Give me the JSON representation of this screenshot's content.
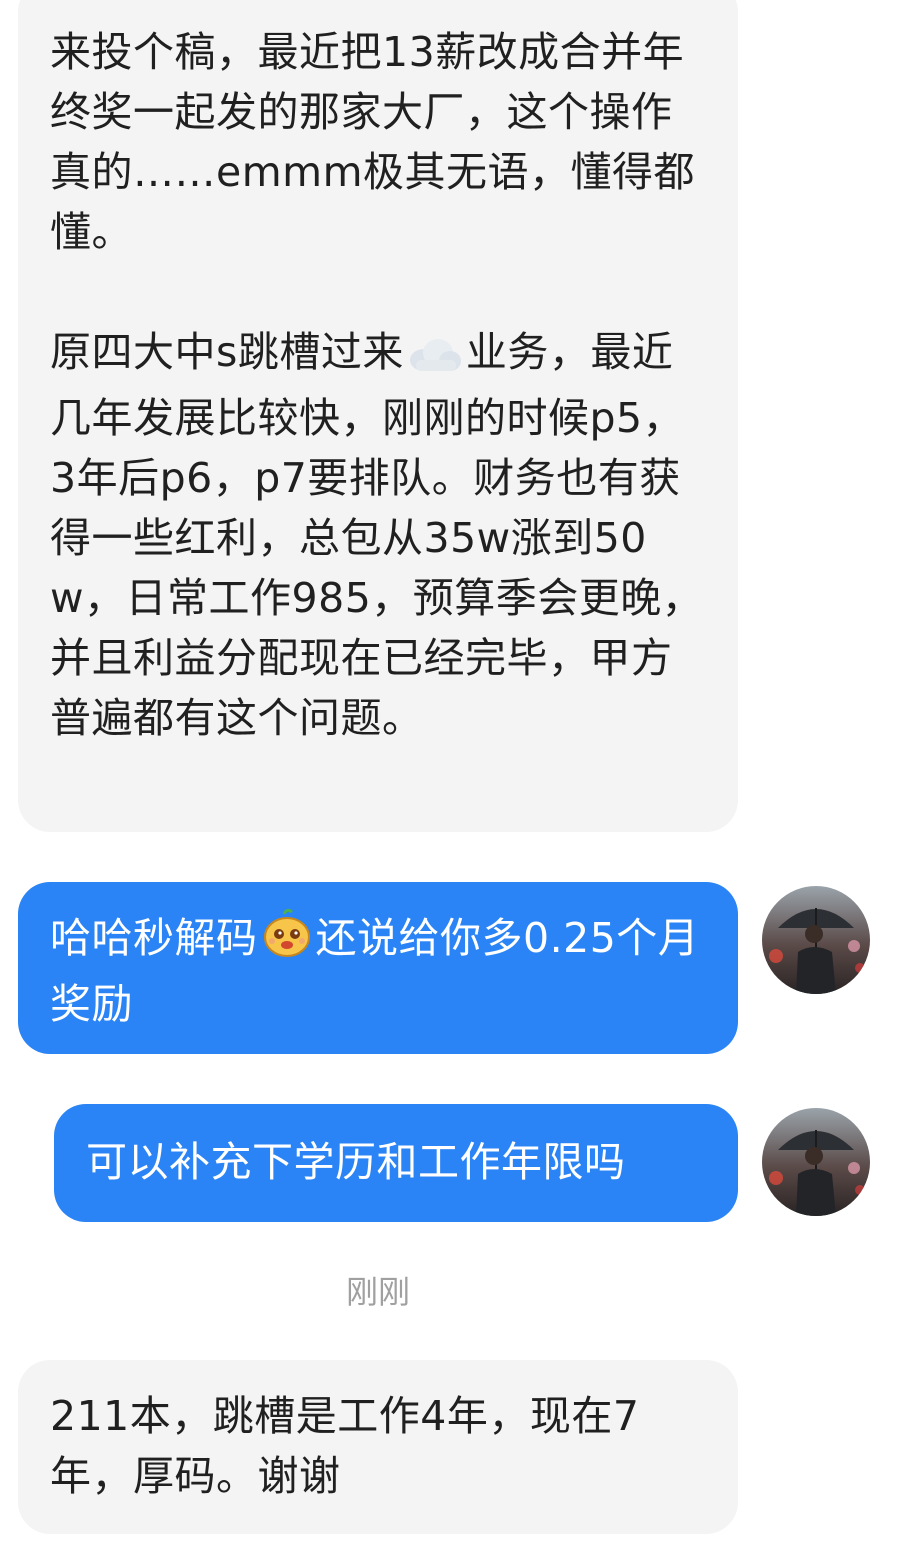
{
  "chat": {
    "msg1": {
      "para1": "来投个稿，最近把13薪改成合并年终奖一起发的那家大厂，这个操作真的……emmm极其无语，懂得都懂。",
      "para2_before_emoji": "原四大中s跳槽过来",
      "para2_emoji": "cloud-icon",
      "para2_after_emoji": "业务，最近几年发展比较快，刚刚的时候p5，3年后p6，p7要排队。财务也有获得一些红利，总包从35w涨到50w，日常工作985，预算季会更晚，并且利益分配现在已经完毕，甲方普遍都有这个问题。"
    },
    "msg2": {
      "before_emoji": "哈哈秒解码",
      "emoji": "smiling-face-sticker-icon",
      "after_emoji": "还说给你多0.25个月奖励"
    },
    "msg3": {
      "text": "可以补充下学历和工作年限吗"
    },
    "timestamp": "刚刚",
    "msg4": {
      "text": "211本，跳槽是工作4年，现在7年，厚码。谢谢"
    },
    "avatar_icon": "user-avatar-umbrella-man",
    "colors": {
      "incoming_bubble": "#f4f4f4",
      "outgoing_bubble": "#2b84f5",
      "timestamp": "#a0a0a0"
    }
  }
}
